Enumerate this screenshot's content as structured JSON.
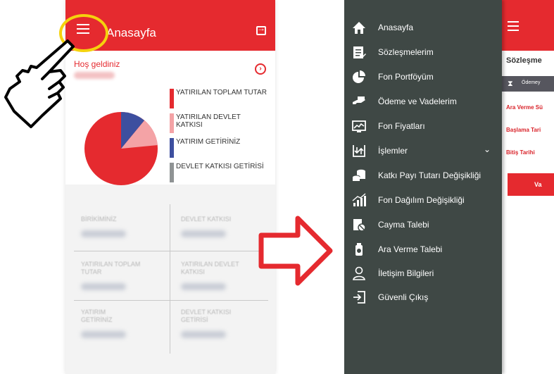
{
  "left_screen": {
    "header": {
      "title": "Anasayfa"
    },
    "welcome": {
      "greeting": "Hoş geldiniz"
    },
    "legend": [
      {
        "label": "YATIRILAN TOPLAM TUTAR",
        "color": "#e52a2f"
      },
      {
        "label": "YATIRILAN DEVLET KATKISI",
        "color": "#f4a3a6"
      },
      {
        "label": "YATIRIM GETİRİNİZ",
        "color": "#3d4f9f"
      },
      {
        "label": "DEVLET KATKISI GETİRİSİ",
        "color": "#8f9394"
      }
    ],
    "summary": [
      {
        "label": "BİRİKİMİNİZ"
      },
      {
        "label": "DEVLET KATKISI"
      },
      {
        "label": "YATIRILAN TOPLAM TUTAR"
      },
      {
        "label": "YATIRILAN DEVLET KATKISI"
      },
      {
        "label": "YATIRIM GETİRİNİZ"
      },
      {
        "label": "DEVLET KATKISI GETİRİSİ"
      }
    ]
  },
  "right_screen": {
    "menu": [
      {
        "label": "Anasayfa",
        "icon": "home-icon"
      },
      {
        "label": "Sözleşmelerim",
        "icon": "contracts-icon"
      },
      {
        "label": "Fon Portföyüm",
        "icon": "pie-chart-icon"
      },
      {
        "label": "Ödeme ve Vadelerim",
        "icon": "payment-icon"
      },
      {
        "label": "Fon Fiyatları",
        "icon": "line-chart-icon"
      },
      {
        "label": "İşlemler",
        "icon": "transactions-icon"
      },
      {
        "label": "Katkı Payı Tutarı Değişikliği",
        "icon": "coins-icon"
      },
      {
        "label": "Fon Dağılım Değişikliği",
        "icon": "bar-chart-icon"
      },
      {
        "label": "Cayma Talebi",
        "icon": "cancel-request-icon"
      },
      {
        "label": "Ara Verme Talebi",
        "icon": "pause-request-icon"
      },
      {
        "label": "İletişim Bilgileri",
        "icon": "contact-icon"
      },
      {
        "label": "Güvenli Çıkış",
        "icon": "logout-icon"
      }
    ],
    "background": {
      "title": "Sözleşme",
      "tab": "Ödemey",
      "rows": [
        "Ara Verme Sü",
        "Başlama Tari",
        "Bitiş Tarihi"
      ],
      "button": "Va"
    }
  },
  "colors": {
    "brand_red": "#e52a2f",
    "menu_bg": "#3f4845",
    "highlight_yellow": "#f5d20d"
  }
}
